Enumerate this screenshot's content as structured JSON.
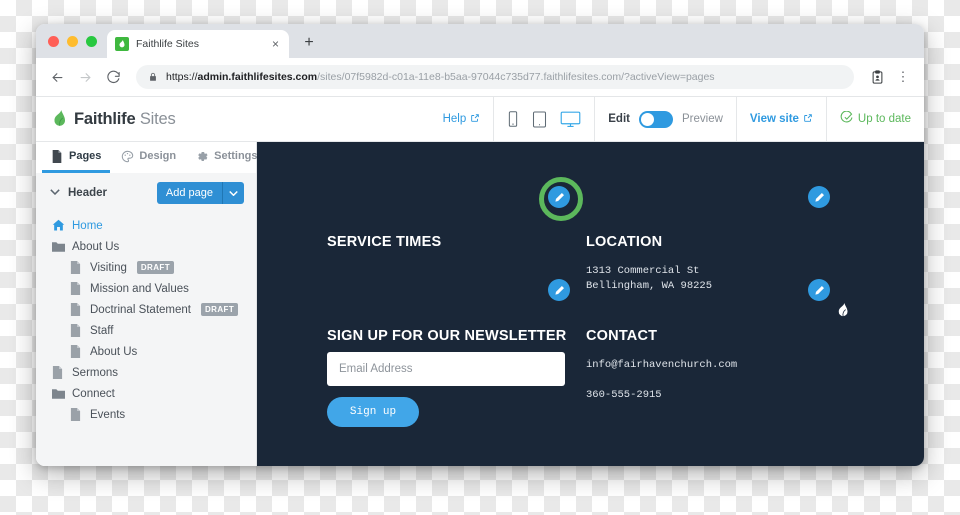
{
  "browser": {
    "tab": {
      "title": "Faithlife Sites",
      "favicon": "faithlife-leaf-icon",
      "close": "×"
    },
    "newtab_label": "+",
    "back_icon": "←",
    "forward_icon": "→",
    "reload_icon": "↻",
    "lock_icon": "lock-icon",
    "url_scheme": "https://",
    "url_host": "admin.faithlifesites.com",
    "url_path": "/sites/07f5982d-c01a-11e8-b5aa-97044c735d77.faithlifesites.com/?activeView=pages",
    "url_full": "https://admin.faithlifesites.com/sites/07f5982d-c01a-11e8-b5aa-97044c735d77.faithlifesites.com/?activeView=pages",
    "profile_icon": "profile-icon",
    "menu_icon": "⋮"
  },
  "app_header": {
    "brand_bold": "Faithlife",
    "brand_light": " Sites",
    "help_label": "Help",
    "external_icon": "↗",
    "devices": [
      {
        "name": "phone",
        "active": false
      },
      {
        "name": "tablet",
        "active": false
      },
      {
        "name": "desktop",
        "active": true
      }
    ],
    "edit_label": "Edit",
    "preview_label": "Preview",
    "toggle_state": "edit",
    "view_site_label": "View site",
    "status_label": "Up to date",
    "status_color": "#5cb85c",
    "accent_color": "#2f9ae0"
  },
  "sidebar": {
    "tabs": [
      {
        "label": "Pages",
        "icon": "document-icon",
        "active": true
      },
      {
        "label": "Design",
        "icon": "palette-icon",
        "active": false
      },
      {
        "label": "Settings",
        "icon": "gear-icon",
        "active": false
      }
    ],
    "section_title": "Header",
    "collapse_icon": "∨",
    "add_page_label": "Add page",
    "add_page_caret": "∨",
    "tree": [
      {
        "label": "Home",
        "icon": "home-icon",
        "indent": 0,
        "active": true,
        "badge": ""
      },
      {
        "label": "About Us",
        "icon": "folder-icon",
        "indent": 0,
        "active": false,
        "badge": ""
      },
      {
        "label": "Visiting",
        "icon": "page-icon",
        "indent": 1,
        "active": false,
        "badge": "DRAFT"
      },
      {
        "label": "Mission and Values",
        "icon": "page-icon",
        "indent": 1,
        "active": false,
        "badge": ""
      },
      {
        "label": "Doctrinal Statement",
        "icon": "page-icon",
        "indent": 1,
        "active": false,
        "badge": "DRAFT"
      },
      {
        "label": "Staff",
        "icon": "page-icon",
        "indent": 1,
        "active": false,
        "badge": ""
      },
      {
        "label": "About Us",
        "icon": "page-icon",
        "indent": 1,
        "active": false,
        "badge": ""
      },
      {
        "label": "Sermons",
        "icon": "page-icon",
        "indent": 0,
        "active": false,
        "badge": ""
      },
      {
        "label": "Connect",
        "icon": "folder-icon",
        "indent": 0,
        "active": false,
        "badge": ""
      },
      {
        "label": "Events",
        "icon": "page-icon",
        "indent": 1,
        "active": false,
        "badge": ""
      }
    ]
  },
  "canvas": {
    "background_color": "#1a2738",
    "service_times_title": "SERVICE TIMES",
    "newsletter_title": "SIGN UP FOR OUR NEWSLETTER",
    "email_placeholder": "Email Address",
    "email_value": "",
    "signup_label": "Sign up",
    "location_title": "LOCATION",
    "address_line1": "1313 Commercial St",
    "address_line2": "Bellingham, WA 98225",
    "contact_title": "CONTACT",
    "contact_email": "info@fairhavenchurch.com",
    "contact_phone": "360-555-2915",
    "edit_buttons": [
      {
        "name": "edit-top-right",
        "highlighted": false
      },
      {
        "name": "edit-logo-block",
        "highlighted": true
      },
      {
        "name": "edit-service-times",
        "highlighted": false
      },
      {
        "name": "edit-location",
        "highlighted": false
      }
    ],
    "cursor_icon": "faithlife-leaf-cursor"
  }
}
